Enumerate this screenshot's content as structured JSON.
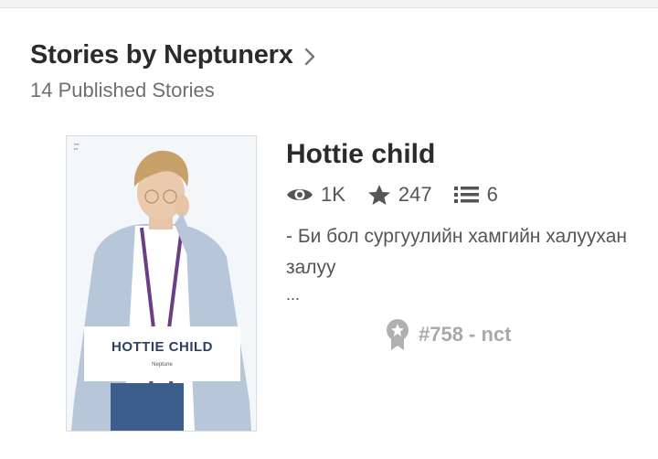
{
  "header": {
    "title": "Stories by Neptunerx",
    "subtitle": "14 Published Stories"
  },
  "story": {
    "title": "Hottie child",
    "cover": {
      "title": "HOTTIE CHILD",
      "author": "Neptune"
    },
    "stats": {
      "reads": "1K",
      "votes": "247",
      "parts": "6"
    },
    "description": "- Би бол сургуулийн хамгийн халуухан залуу",
    "ellipsis": "...",
    "rank": "#758 - nct"
  },
  "icons": {
    "header": "chevron-right-icon",
    "reads": "eye-icon",
    "votes": "star-icon",
    "parts": "list-icon",
    "rank": "ribbon-badge-icon"
  },
  "colors": {
    "title": "#2b2b2b",
    "subtitle": "#6f6f6f",
    "rank": "#a9a9a9",
    "cover_title": "#2f3f63"
  }
}
